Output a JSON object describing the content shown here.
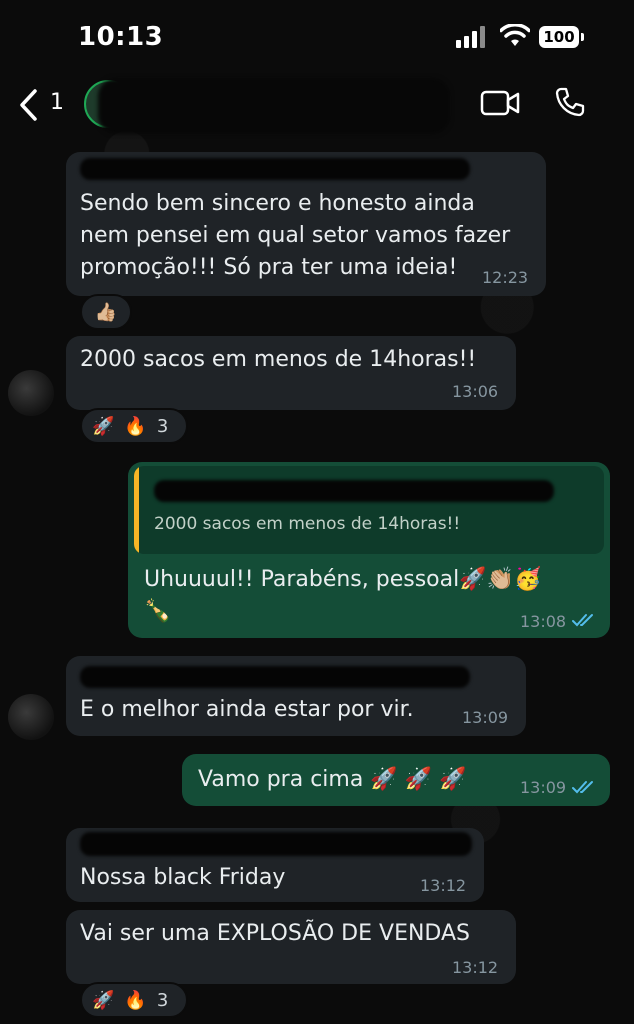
{
  "status_bar": {
    "time": "10:13",
    "battery": "100"
  },
  "header": {
    "unread_count": "1"
  },
  "messages": [
    {
      "text_lines": [
        "Sendo bem sincero e honesto ainda",
        "nem pensei em qual setor vamos fazer",
        "promoção!!! Só pra ter uma ideia!"
      ],
      "time": "12:23",
      "reaction": "👍🏼"
    },
    {
      "text": "2000 sacos em menos de 14horas!!",
      "time": "13:06",
      "reactions": [
        "🚀",
        "🔥"
      ],
      "reaction_count": "3"
    },
    {
      "quote_text": "2000 sacos em menos de 14horas!!",
      "text": "Uhuuuul!! Parabéns, pessoal🚀👏🏼🥳",
      "text_line2": "🍾",
      "time": "13:08"
    },
    {
      "text": "E o melhor ainda estar por vir.",
      "time": "13:09"
    },
    {
      "text": "Vamo pra cima 🚀 🚀 🚀",
      "time": "13:09"
    },
    {
      "text": "Nossa black Friday",
      "time": "13:12"
    },
    {
      "text": "Vai ser uma EXPLOSÃO DE VENDAS",
      "time": "13:12",
      "reactions": [
        "🚀",
        "🔥"
      ],
      "reaction_count": "3"
    }
  ],
  "colors": {
    "incoming": "#202c33",
    "outgoing": "#144d37",
    "read_ticks": "#53bdeb",
    "quote_bar": "#f7b626"
  },
  "icons": [
    "back-icon",
    "video-call-icon",
    "phone-icon",
    "signal-icon",
    "wifi-icon",
    "battery-icon"
  ]
}
